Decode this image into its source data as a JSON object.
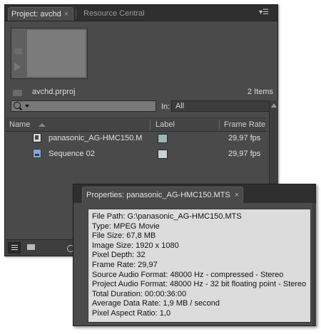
{
  "project_panel": {
    "tabs": [
      {
        "label": "Project: avchd",
        "close": "×"
      },
      {
        "label": "Resource Central"
      }
    ],
    "menu_icon": "panel-menu-icon",
    "project_name": "avchd.prproj",
    "items_count": "2 Items",
    "search_placeholder": "",
    "in_label": "In:",
    "in_value": "All",
    "columns": [
      "Name",
      "Label",
      "Frame Rate"
    ],
    "rows": [
      {
        "name": "panasonic_AG-HMC150.M",
        "icon": "clip-icon",
        "label_color": "#9cb7b1",
        "frame_rate": "29,97 fps"
      },
      {
        "name": "Sequence 02",
        "icon": "sequence-icon",
        "label_color": "#c8d2d6",
        "frame_rate": "29,97 fps"
      }
    ]
  },
  "properties_panel": {
    "tab": {
      "label": "Properties: panasonic_AG-HMC150.MTS",
      "close": "×"
    },
    "lines": [
      "File Path: G:\\panasonic_AG-HMC150.MTS",
      "Type: MPEG Movie",
      "File Size: 67,8 MB",
      "Image Size: 1920 x 1080",
      "Pixel Depth: 32",
      "Frame Rate: 29,97",
      "Source Audio Format: 48000 Hz - compressed - Stereo",
      "Project Audio Format: 48000 Hz - 32 bit floating point - Stereo",
      "Total Duration: 00:00:36:00",
      "Average Data Rate: 1,9 MB / second",
      "Pixel Aspect Ratio: 1,0"
    ]
  }
}
